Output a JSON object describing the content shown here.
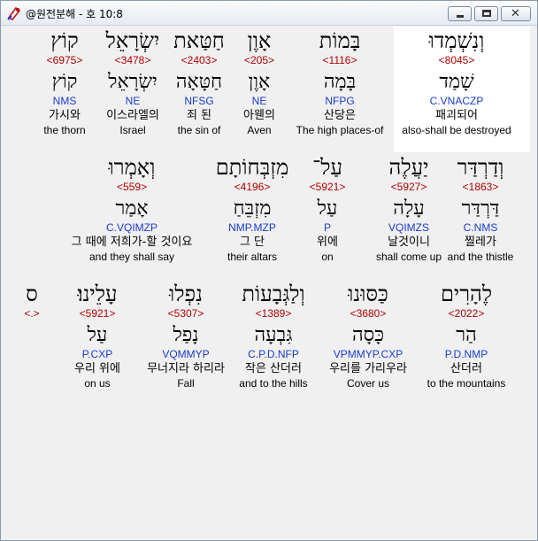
{
  "window": {
    "title": "@원전분해 - 호 10:8"
  },
  "colors": {
    "strong": "#b00000",
    "code": "#1a3ccc",
    "highlight": "#ffffff"
  },
  "rows": [
    [
      {
        "heb": "וְנִשְׁמְדוּ",
        "strong": "<8045>",
        "lemma": "שָׁמַד",
        "code": "C.VNACZP",
        "kor": "패괴되어",
        "eng": "also-shall be destroyed"
      },
      {
        "heb": "בָּמוֹת",
        "strong": "<1116>",
        "lemma": "בָּמָה",
        "code": "NFPG",
        "kor": "산당은",
        "eng": "The high places-of"
      },
      {
        "heb": "אָוֶן",
        "strong": "<205>",
        "lemma": "אָוֶן",
        "code": "NE",
        "kor": "아웬의",
        "eng": "Aven"
      },
      {
        "heb": "חַטַּאת",
        "strong": "<2403>",
        "lemma": "חַטָּאָה",
        "code": "NFSG",
        "kor": "죄 된",
        "eng": "the sin of"
      },
      {
        "heb": "יִשְׂרָאֵל",
        "strong": "<3478>",
        "lemma": "יִשְׂרָאֵל",
        "code": "NE",
        "kor": "이스라엘의",
        "eng": "Israel"
      },
      {
        "heb": "קוֹץ",
        "strong": "<6975>",
        "lemma": "קוֹץ",
        "code": "NMS",
        "kor": "가시와",
        "eng": "the thorn"
      }
    ],
    [
      {
        "heb": "וְדַרְדַּר",
        "strong": "<1863>",
        "lemma": "דַּרְדַּר",
        "code": "C.NMS",
        "kor": "찔레가",
        "eng": "and the thistle"
      },
      {
        "heb": "יַעֲלֶה",
        "strong": "<5927>",
        "lemma": "עָלָה",
        "code": "VQIMZS",
        "kor": "날것이니",
        "eng": "shall come up"
      },
      {
        "heb": "עַל־",
        "strong": "<5921>",
        "lemma": "עַל",
        "code": "P",
        "kor": "위에",
        "eng": "on"
      },
      {
        "heb": "מִזְבְּחוֹתָם",
        "strong": "<4196>",
        "lemma": "מִזְבֵּחַ",
        "code": "NMP.MZP",
        "kor": "그 단",
        "eng": "their altars"
      },
      {
        "heb": "וְאָמְרוּ",
        "strong": "<559>",
        "lemma": "אָמַר",
        "code": "C.VQIMZP",
        "kor": "그 때에 저희가-할 것이요",
        "eng": "and they shall say"
      }
    ],
    [
      {
        "heb": "לֶהָרִים",
        "strong": "<2022>",
        "lemma": "הַר",
        "code": "P.D.NMP",
        "kor": "산더러",
        "eng": "to the mountains"
      },
      {
        "heb": "כַּסּוּנוּ",
        "strong": "<3680>",
        "lemma": "כָּסָה",
        "code": "VPMMYP.CXP",
        "kor": "우리를 가리우라",
        "eng": "Cover us"
      },
      {
        "heb": "וְלַגְּבָעוֹת",
        "strong": "<1389>",
        "lemma": "גִּבְעָה",
        "code": "C.P.D.NFP",
        "kor": "작은 산더러",
        "eng": "and to the hills"
      },
      {
        "heb": "נִפְלוּ",
        "strong": "<5307>",
        "lemma": "נָפַל",
        "code": "VQMMYP",
        "kor": "무너지라 하리라",
        "eng": "Fall"
      },
      {
        "heb": "עָלֵינוּ׃",
        "strong": "<5921>",
        "lemma": "עַל",
        "code": "P.CXP",
        "kor": "우리 위에",
        "eng": "on us"
      },
      {
        "heb": "ס",
        "strong": "<.>",
        "lemma": "",
        "code": "",
        "kor": "",
        "eng": ""
      }
    ]
  ]
}
